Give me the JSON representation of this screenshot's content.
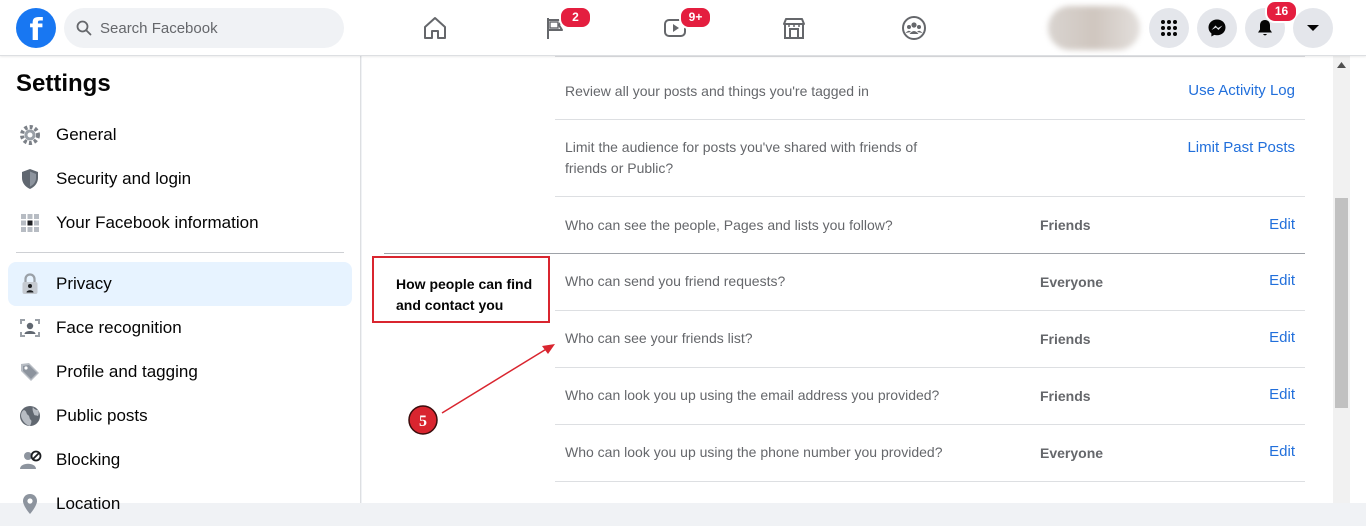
{
  "header": {
    "search": {
      "placeholder": "Search Facebook"
    },
    "nav": [
      {
        "name": "home",
        "badge": ""
      },
      {
        "name": "pages",
        "badge": "2"
      },
      {
        "name": "watch",
        "badge": "9+"
      },
      {
        "name": "marketplace",
        "badge": ""
      },
      {
        "name": "groups",
        "badge": ""
      }
    ],
    "notifications_badge": "16"
  },
  "sidebar": {
    "title": "Settings",
    "items": [
      {
        "label": "General",
        "icon": "gear-icon"
      },
      {
        "label": "Security and login",
        "icon": "shield-icon"
      },
      {
        "label": "Your Facebook information",
        "icon": "grid-info-icon"
      },
      {
        "label": "Privacy",
        "icon": "lock-icon",
        "active": true
      },
      {
        "label": "Face recognition",
        "icon": "face-icon"
      },
      {
        "label": "Profile and tagging",
        "icon": "tag-icon"
      },
      {
        "label": "Public posts",
        "icon": "globe-icon"
      },
      {
        "label": "Blocking",
        "icon": "blocked-user-icon"
      },
      {
        "label": "Location",
        "icon": "location-icon"
      }
    ]
  },
  "privacy": {
    "rows": [
      {
        "question": "Review all your posts and things you're tagged in",
        "value": "",
        "action": "Use Activity Log"
      },
      {
        "question": "Limit the audience for posts you've shared with friends of friends or Public?",
        "value": "",
        "action": "Limit Past Posts"
      },
      {
        "question": "Who can see the people, Pages and lists you follow?",
        "value": "Friends",
        "action": "Edit"
      },
      {
        "question": "Who can send you friend requests?",
        "value": "Everyone",
        "action": "Edit"
      },
      {
        "question": "Who can see your friends list?",
        "value": "Friends",
        "action": "Edit"
      },
      {
        "question": "Who can look you up using the email address you provided?",
        "value": "Friends",
        "action": "Edit"
      },
      {
        "question": "Who can look you up using the phone number you provided?",
        "value": "Everyone",
        "action": "Edit"
      }
    ],
    "section_label": "How people can find and contact you"
  },
  "annotation": {
    "step_number": "5",
    "color": "#d9252f"
  },
  "colors": {
    "brand": "#1877f2",
    "link": "#216fdb",
    "badge": "#e41e3f"
  }
}
